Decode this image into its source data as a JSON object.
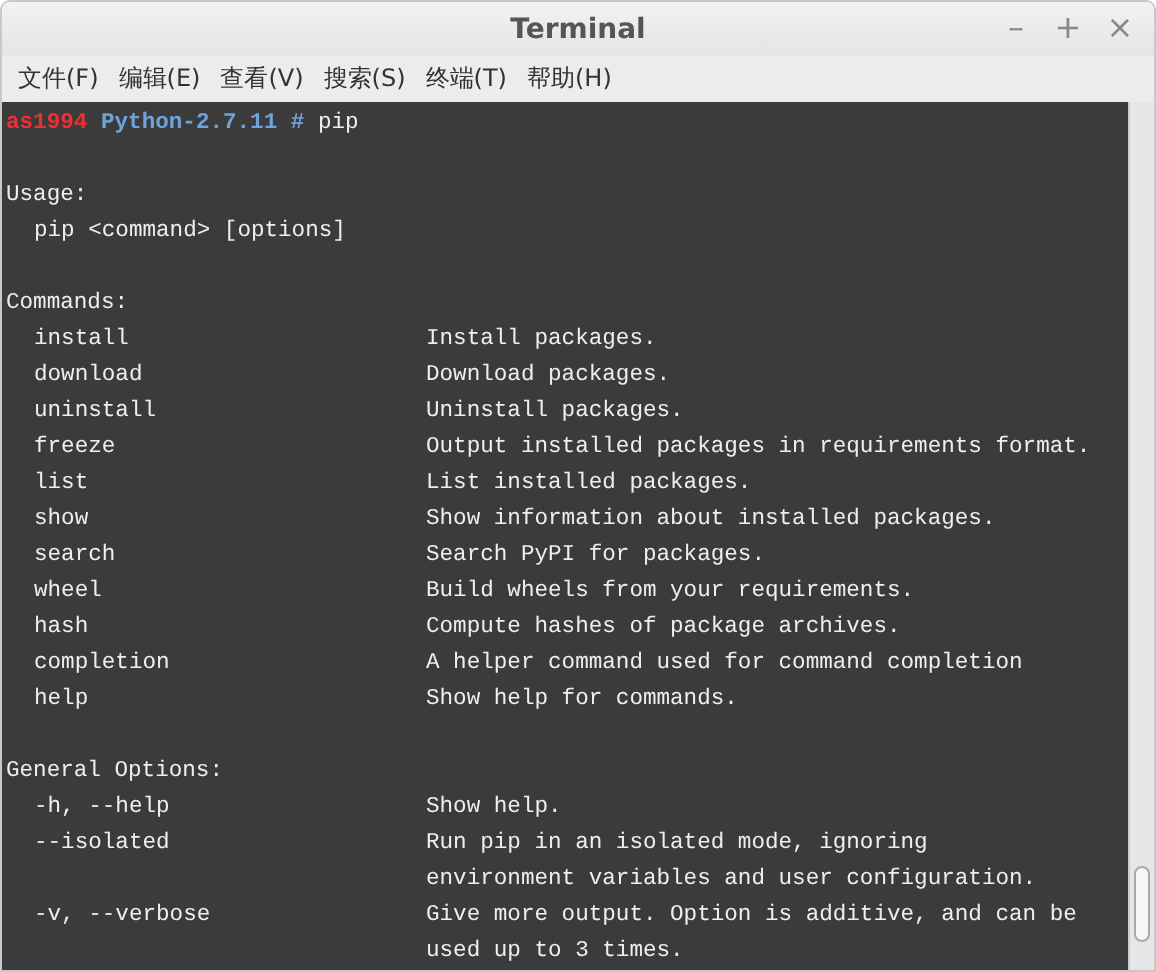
{
  "window": {
    "title": "Terminal",
    "controls": [
      "–",
      "+",
      "×"
    ]
  },
  "menu": [
    "文件(F)",
    "编辑(E)",
    "查看(V)",
    "搜索(S)",
    "终端(T)",
    "帮助(H)"
  ],
  "prompt": {
    "user": "as1994",
    "directory": "Python-2.7.11",
    "symbol": "#",
    "command": "pip"
  },
  "output": [
    {
      "kind": "blank"
    },
    {
      "kind": "heading",
      "text": "Usage:"
    },
    {
      "kind": "text",
      "text": "pip <command> [options]"
    },
    {
      "kind": "blank"
    },
    {
      "kind": "heading",
      "text": "Commands:"
    },
    {
      "kind": "entry",
      "name": "install",
      "description": [
        "Install packages."
      ]
    },
    {
      "kind": "entry",
      "name": "download",
      "description": [
        "Download packages."
      ]
    },
    {
      "kind": "entry",
      "name": "uninstall",
      "description": [
        "Uninstall packages."
      ]
    },
    {
      "kind": "entry",
      "name": "freeze",
      "description": [
        "Output installed packages in requirements format."
      ]
    },
    {
      "kind": "entry",
      "name": "list",
      "description": [
        "List installed packages."
      ]
    },
    {
      "kind": "entry",
      "name": "show",
      "description": [
        "Show information about installed packages."
      ]
    },
    {
      "kind": "entry",
      "name": "search",
      "description": [
        "Search PyPI for packages."
      ]
    },
    {
      "kind": "entry",
      "name": "wheel",
      "description": [
        "Build wheels from your requirements."
      ]
    },
    {
      "kind": "entry",
      "name": "hash",
      "description": [
        "Compute hashes of package archives."
      ]
    },
    {
      "kind": "entry",
      "name": "completion",
      "description": [
        "A helper command used for command completion"
      ]
    },
    {
      "kind": "entry",
      "name": "help",
      "description": [
        "Show help for commands."
      ]
    },
    {
      "kind": "blank"
    },
    {
      "kind": "heading",
      "text": "General Options:"
    },
    {
      "kind": "entry",
      "name": "-h, --help",
      "description": [
        "Show help."
      ]
    },
    {
      "kind": "entry",
      "name": "--isolated",
      "description": [
        "Run pip in an isolated mode, ignoring",
        "environment variables and user configuration."
      ]
    },
    {
      "kind": "entry",
      "name": "-v, --verbose",
      "description": [
        "Give more output. Option is additive, and can be",
        "used up to 3 times."
      ]
    }
  ]
}
